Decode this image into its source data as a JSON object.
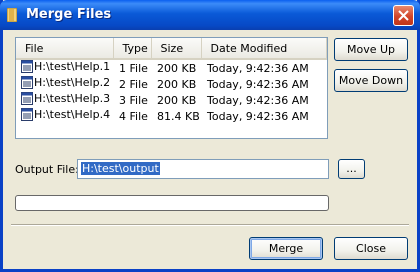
{
  "window": {
    "title": "Merge Files"
  },
  "file_list": {
    "columns": [
      "File",
      "Type",
      "Size",
      "Date Modified"
    ],
    "rows": [
      {
        "file": "H:\\test\\Help.1",
        "type": "1 File",
        "size": "200 KB",
        "date": "Today, 9:42:36 AM"
      },
      {
        "file": "H:\\test\\Help.2",
        "type": "2 File",
        "size": "200 KB",
        "date": "Today, 9:42:36 AM"
      },
      {
        "file": "H:\\test\\Help.3",
        "type": "3 File",
        "size": "200 KB",
        "date": "Today, 9:42:36 AM"
      },
      {
        "file": "H:\\test\\Help.4",
        "type": "4 File",
        "size": "81.4 KB",
        "date": "Today, 9:42:36 AM"
      }
    ]
  },
  "buttons": {
    "move_up": "Move Up",
    "move_down": "Move Down",
    "browse": "...",
    "merge": "Merge",
    "close": "Close"
  },
  "output": {
    "label": "Output File:",
    "value": "H:\\test\\output"
  },
  "progress": {
    "value": 0
  },
  "colors": {
    "titlebar": "#0a5ad8",
    "selection": "#316ac5",
    "window_bg": "#ece9d8"
  },
  "icons": {
    "title": "folder-icon",
    "file": "file-icon",
    "close": "close-icon"
  }
}
